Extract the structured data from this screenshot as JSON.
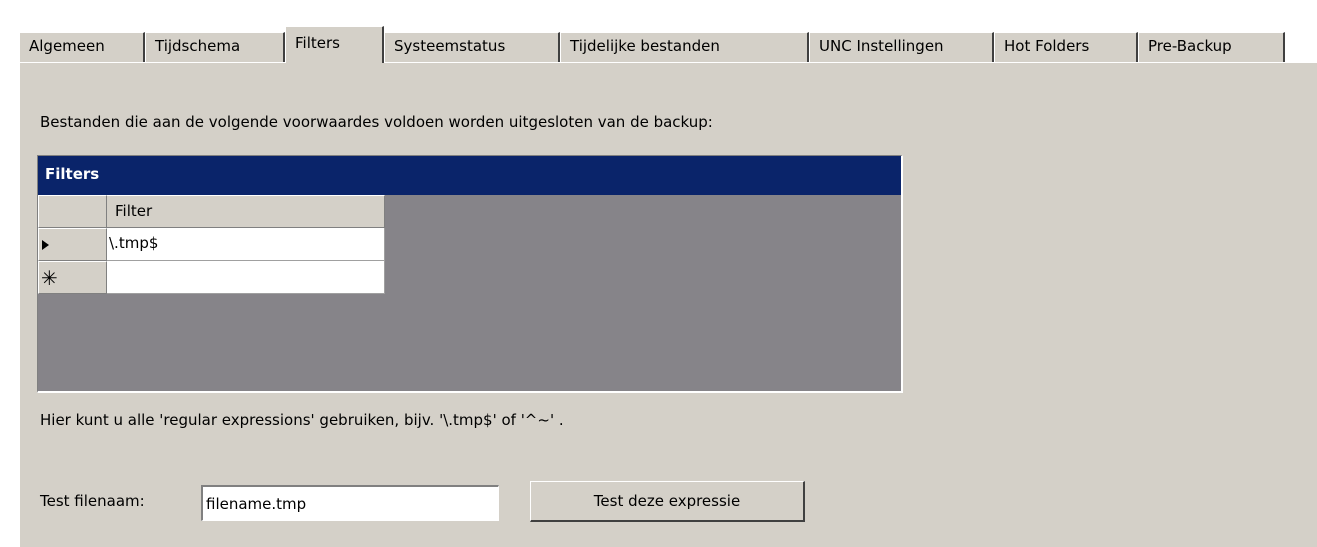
{
  "tabs": [
    {
      "label": "Algemeen",
      "active": false
    },
    {
      "label": "Tijdschema",
      "active": false
    },
    {
      "label": "Filters",
      "active": true
    },
    {
      "label": "Systeemstatus",
      "active": false
    },
    {
      "label": "Tijdelijke bestanden",
      "active": false
    },
    {
      "label": "UNC Instellingen",
      "active": false
    },
    {
      "label": "Hot Folders",
      "active": false
    },
    {
      "label": "Pre-Backup",
      "active": false
    }
  ],
  "panel": {
    "description": "Bestanden die aan de volgende voorwaardes voldoen worden uitgesloten van de backup:",
    "grid": {
      "caption": "Filters",
      "column_header": "Filter",
      "rows": [
        {
          "indicator": "current-row-icon",
          "value": "\\.tmp$"
        },
        {
          "indicator": "new-row-icon",
          "value": ""
        }
      ]
    },
    "hint": "Hier kunt u alle 'regular expressions' gebruiken, bijv. '\\.tmp$' of '^~' .",
    "test": {
      "label": "Test filenaam:",
      "input_value": "filename.tmp",
      "button_label": "Test deze expressie"
    }
  }
}
